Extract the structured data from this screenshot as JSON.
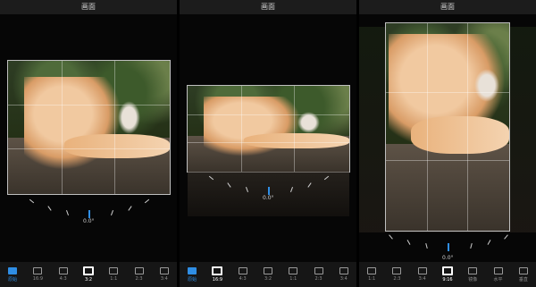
{
  "panels": [
    {
      "title": "画面",
      "angle": "0.0°",
      "toolbar": [
        {
          "label": "原始",
          "state": "blue"
        },
        {
          "label": "16:9",
          "state": ""
        },
        {
          "label": "4:3",
          "state": ""
        },
        {
          "label": "3:2",
          "state": "sel"
        },
        {
          "label": "1:1",
          "state": ""
        },
        {
          "label": "2:3",
          "state": ""
        },
        {
          "label": "3:4",
          "state": ""
        }
      ]
    },
    {
      "title": "画面",
      "angle": "0.0°",
      "toolbar": [
        {
          "label": "原始",
          "state": "blue"
        },
        {
          "label": "16:9",
          "state": "sel"
        },
        {
          "label": "4:3",
          "state": ""
        },
        {
          "label": "3:2",
          "state": ""
        },
        {
          "label": "1:1",
          "state": ""
        },
        {
          "label": "2:3",
          "state": ""
        },
        {
          "label": "3:4",
          "state": ""
        }
      ]
    },
    {
      "title": "画面",
      "angle": "0.0°",
      "toolbar": [
        {
          "label": "1:1",
          "state": ""
        },
        {
          "label": "2:3",
          "state": ""
        },
        {
          "label": "3:4",
          "state": ""
        },
        {
          "label": "9:16",
          "state": "sel"
        },
        {
          "label": "镜像",
          "state": ""
        },
        {
          "label": "水平",
          "state": ""
        },
        {
          "label": "垂直",
          "state": ""
        }
      ]
    }
  ],
  "icons": {
    "ratio": "ratio-frame-icon",
    "mirror": "mirror-icon",
    "flip": "flip-icon"
  }
}
